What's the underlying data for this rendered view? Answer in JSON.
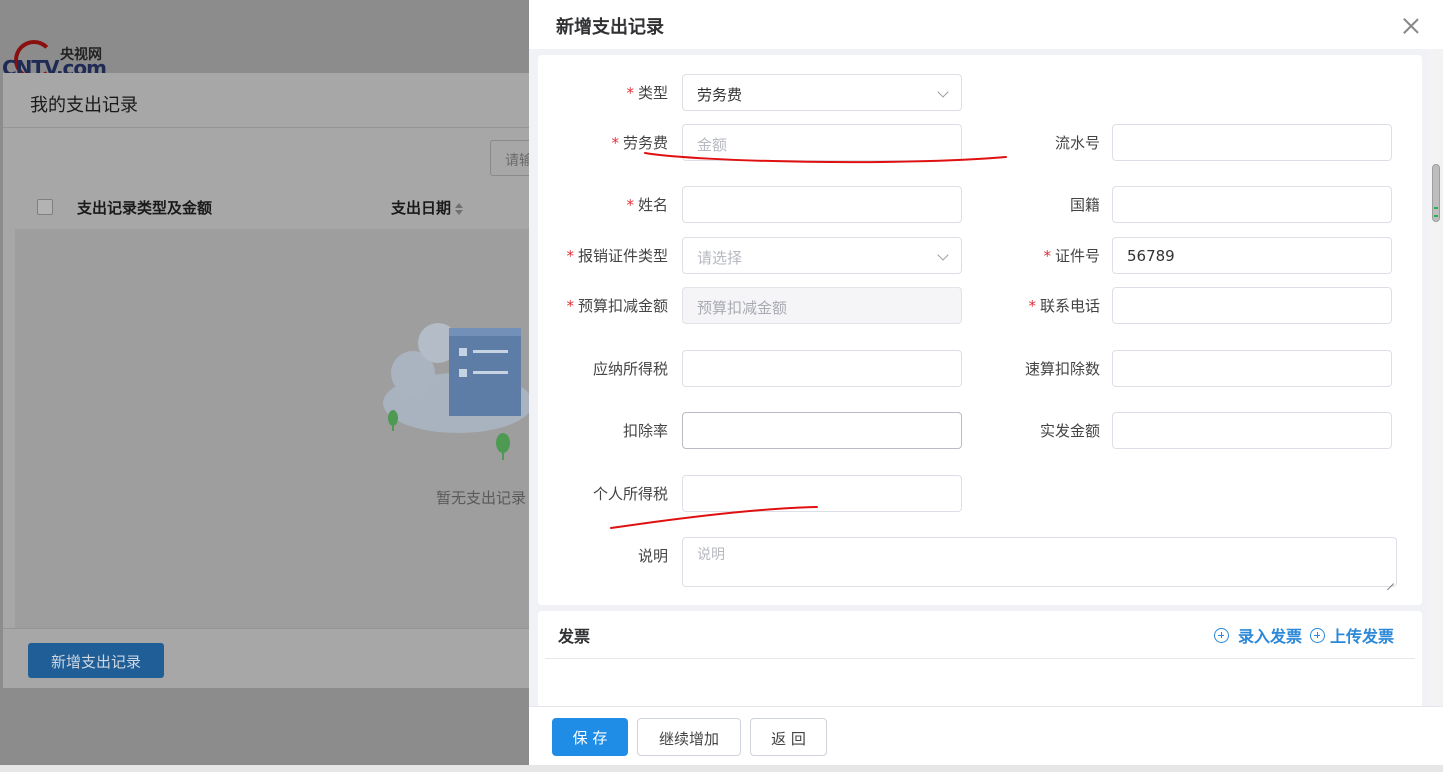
{
  "background": {
    "logo_cn": "央视网",
    "logo_en": "CNTV.com",
    "panel_title": "我的支出记录",
    "search_placeholder": "请输",
    "table_columns": [
      "支出记录类型及金额",
      "支出日期"
    ],
    "empty_text": "暂无支出记录",
    "add_button": "新增支出记录"
  },
  "drawer": {
    "title": "新增支出记录",
    "form": {
      "type": {
        "label": "类型",
        "required": true,
        "value": "劳务费"
      },
      "labor_fee": {
        "label": "劳务费",
        "required": true,
        "placeholder": "金额",
        "value": ""
      },
      "serial_no": {
        "label": "流水号",
        "required": false,
        "value": ""
      },
      "name": {
        "label": "姓名",
        "required": true,
        "value": ""
      },
      "nationality": {
        "label": "国籍",
        "required": false,
        "value": ""
      },
      "id_type": {
        "label": "报销证件类型",
        "required": true,
        "placeholder": "请选择",
        "value": ""
      },
      "id_number": {
        "label": "证件号",
        "required": true,
        "value": "56789"
      },
      "budget_deduct": {
        "label": "预算扣减金额",
        "required": true,
        "placeholder": "预算扣减金额",
        "value": ""
      },
      "phone": {
        "label": "联系电话",
        "required": true,
        "value": ""
      },
      "taxable_income": {
        "label": "应纳所得税",
        "required": false,
        "value": ""
      },
      "quick_deduction": {
        "label": "速算扣除数",
        "required": false,
        "value": ""
      },
      "deduction_rate": {
        "label": "扣除率",
        "required": false,
        "value": ""
      },
      "net_amount": {
        "label": "实发金额",
        "required": false,
        "value": ""
      },
      "personal_tax": {
        "label": "个人所得税",
        "required": false,
        "value": ""
      },
      "note": {
        "label": "说明",
        "required": false,
        "placeholder": "说明",
        "value": ""
      }
    },
    "invoice": {
      "title": "发票",
      "enter_invoice": "录入发票",
      "upload_invoice": "上传发票"
    },
    "footer": {
      "save": "保 存",
      "continue_add": "继续增加",
      "back": "返 回"
    }
  },
  "colors": {
    "primary": "#1f8ce6",
    "link": "#2b88d8",
    "required": "#e0303a",
    "annotation": "#e01010"
  }
}
